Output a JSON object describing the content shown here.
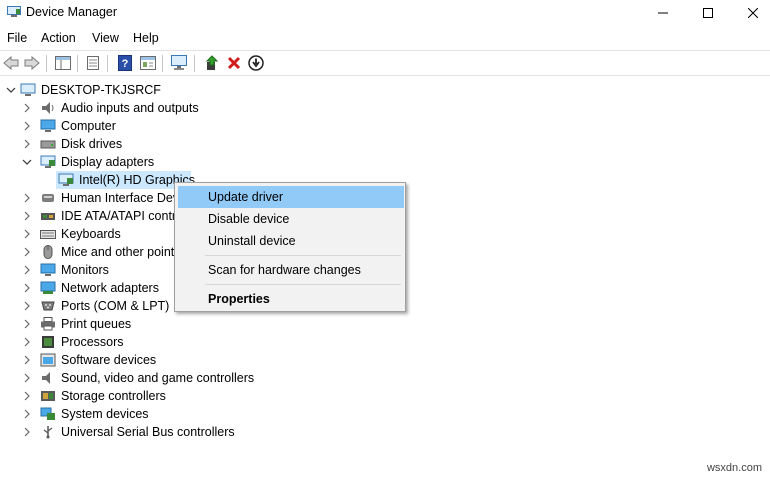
{
  "window": {
    "title": "Device Manager",
    "icon": "device-manager-icon"
  },
  "window_controls": {
    "minimize": "minimize-icon",
    "maximize": "maximize-icon",
    "close": "close-icon"
  },
  "menu": [
    "File",
    "Action",
    "View",
    "Help"
  ],
  "toolbar": [
    "back-icon",
    "forward-icon",
    "properties-pane-icon",
    "list-view-icon",
    "help-icon",
    "details-icon",
    "scan-monitor-icon",
    "update-driver-icon",
    "uninstall-icon",
    "disable-icon"
  ],
  "tree": {
    "root": "DESKTOP-TKJSRCF",
    "categories": [
      {
        "label": "Audio inputs and outputs",
        "expanded": false
      },
      {
        "label": "Computer",
        "expanded": false
      },
      {
        "label": "Disk drives",
        "expanded": false
      },
      {
        "label": "Display adapters",
        "expanded": true
      },
      {
        "label": "Human Interface Dev",
        "expanded": false
      },
      {
        "label": "IDE ATA/ATAPI contro",
        "expanded": false
      },
      {
        "label": "Keyboards",
        "expanded": false
      },
      {
        "label": "Mice and other point",
        "expanded": false
      },
      {
        "label": "Monitors",
        "expanded": false
      },
      {
        "label": "Network adapters",
        "expanded": false
      },
      {
        "label": "Ports (COM & LPT)",
        "expanded": false
      },
      {
        "label": "Print queues",
        "expanded": false
      },
      {
        "label": "Processors",
        "expanded": false
      },
      {
        "label": "Software devices",
        "expanded": false
      },
      {
        "label": "Sound, video and game controllers",
        "expanded": false
      },
      {
        "label": "Storage controllers",
        "expanded": false
      },
      {
        "label": "System devices",
        "expanded": false
      },
      {
        "label": "Universal Serial Bus controllers",
        "expanded": false
      }
    ],
    "selected_device": "Intel(R) HD Graphics"
  },
  "context_menu": {
    "items": [
      "Update driver",
      "Disable device",
      "Uninstall device",
      "Scan for hardware changes",
      "Properties"
    ],
    "highlighted": "Update driver",
    "bold": "Properties"
  },
  "watermark": "wsxdn.com",
  "colors": {
    "selection": "#cce8ff",
    "menu_highlight": "#91c9f7",
    "menu_bg": "#f2f2f2"
  }
}
